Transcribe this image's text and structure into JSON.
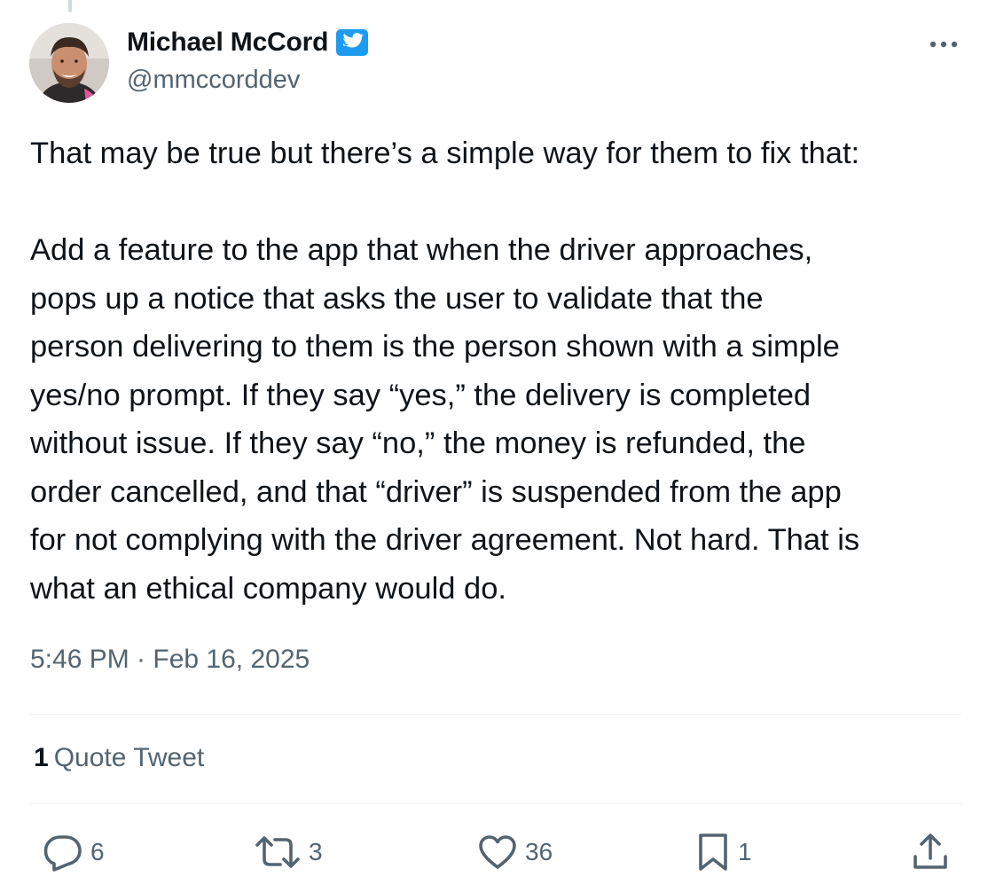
{
  "author": {
    "display_name": "Michael McCord",
    "handle": "@mmccorddev",
    "verified": true
  },
  "tweet": {
    "text": "That may be true but there’s a simple way for them to fix that:\n\nAdd a feature to the app that when the driver approaches,\npops up a notice that asks the user to validate that the\nperson delivering to them is the person shown with a simple\nyes/no prompt. If they say “yes,” the delivery is completed\nwithout issue. If they say “no,” the money is refunded, the\norder cancelled, and that “driver” is suspended from the app\nfor not complying with the driver agreement. Not hard. That is\nwhat an ethical company would do.",
    "timestamp": "5:46 PM · Feb 16, 2025"
  },
  "engagement": {
    "quote_count": "1",
    "quote_label": "Quote Tweet"
  },
  "actions": {
    "replies": "6",
    "retweets": "3",
    "likes": "36",
    "bookmarks": "1"
  },
  "colors": {
    "text_primary": "#0f1419",
    "text_secondary": "#536471",
    "verified_blue": "#1d9bf0",
    "divider": "#eff3f4"
  },
  "icons": {
    "verified": "verified-badge-icon",
    "more": "more-horizontal-icon",
    "reply": "reply-icon",
    "retweet": "retweet-icon",
    "like": "heart-icon",
    "bookmark": "bookmark-icon",
    "share": "share-icon"
  }
}
